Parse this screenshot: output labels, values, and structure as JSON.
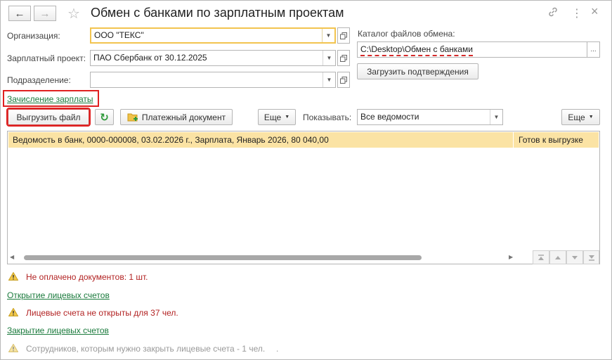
{
  "window": {
    "title": "Обмен с банками по зарплатным проектам"
  },
  "icons": {
    "back": "←",
    "forward": "→",
    "star": "☆",
    "link": "🔗",
    "menu": "⋮",
    "close": "×",
    "dropdown": "▼",
    "open": "⧉",
    "refresh": "↻",
    "ellipsis": "..."
  },
  "form": {
    "organization_label": "Организация:",
    "organization_value": "ООО \"ТЕКС\"",
    "salary_project_label": "Зарплатный проект:",
    "salary_project_value": "ПАО Сбербанк от 30.12.2025",
    "department_label": "Подразделение:",
    "department_value": "",
    "catalog_label": "Каталог файлов обмена:",
    "catalog_value": "C:\\Desktop\\Обмен с банками",
    "load_confirmations": "Загрузить подтверждения",
    "salary_accrual_link": "Зачисление зарплаты"
  },
  "toolbar": {
    "export_file": "Выгрузить файл",
    "payment_doc": "Платежный документ",
    "more_left": "Еще",
    "show_label": "Показывать:",
    "show_value": "Все ведомости",
    "more_right": "Еще"
  },
  "table": {
    "rows": [
      {
        "description": "Ведомость в банк, 0000-000008, 03.02.2026 г., Зарплата, Январь 2026, 80 040,00",
        "status": "Готов к выгрузке"
      }
    ]
  },
  "messages": {
    "unpaid": "Не оплачено документов: 1 шт.",
    "open_accounts_link": "Открытие лицевых счетов",
    "accounts_not_opened": "Лицевые счета не открыты для 37 чел.",
    "close_accounts_link": "Закрытие лицевых счетов",
    "employees_to_close": "Сотрудников, которым нужно закрыть лицевые счета - 1 чел.",
    "trailing_dot": "."
  },
  "colors": {
    "accent_yellow": "#f2c44f",
    "row_highlight": "#fbe3a4",
    "link_green": "#1a7a3c",
    "warning_red": "#b22222",
    "highlight_box": "#e02020"
  }
}
